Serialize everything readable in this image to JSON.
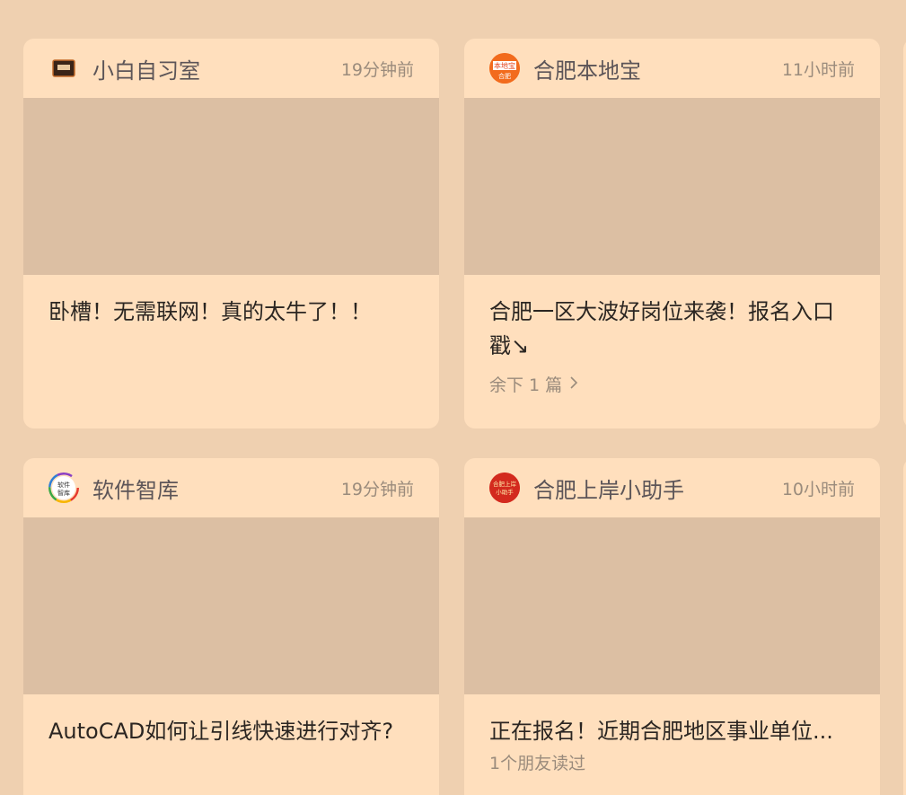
{
  "cards": [
    {
      "source": "小白自习室",
      "time": "19分钟前",
      "title": "卧槽！无需联网！真的太牛了！！",
      "avatar_icon": "laptop-icon"
    },
    {
      "source": "合肥本地宝",
      "time": "11小时前",
      "title": "合肥一区大波好岗位来袭！报名入口戳↘",
      "more": "余下 1 篇",
      "avatar_icon": "bendibao-logo-icon",
      "avatar_text": [
        "本地宝",
        "合肥"
      ]
    },
    {
      "source": "软件智库",
      "time": "19分钟前",
      "title": "AutoCAD如何让引线快速进行对齐?",
      "avatar_icon": "ruanjian-zhiku-logo-icon",
      "avatar_text": [
        "软件",
        "智库"
      ]
    },
    {
      "source": "合肥上岸小助手",
      "time": "10小时前",
      "title": "正在报名！近期合肥地区事业单位...",
      "friends": "1个朋友读过",
      "avatar_icon": "shangan-logo-icon",
      "avatar_text": [
        "合肥上岸",
        "小助手"
      ]
    }
  ],
  "colors": {
    "background": "#efd0b0",
    "card": "#ffdfbd",
    "thumbnail": "#dcbfa3",
    "source_text": "#5c5558",
    "meta_text": "#9a8b7c",
    "title_text": "#2b2622"
  }
}
